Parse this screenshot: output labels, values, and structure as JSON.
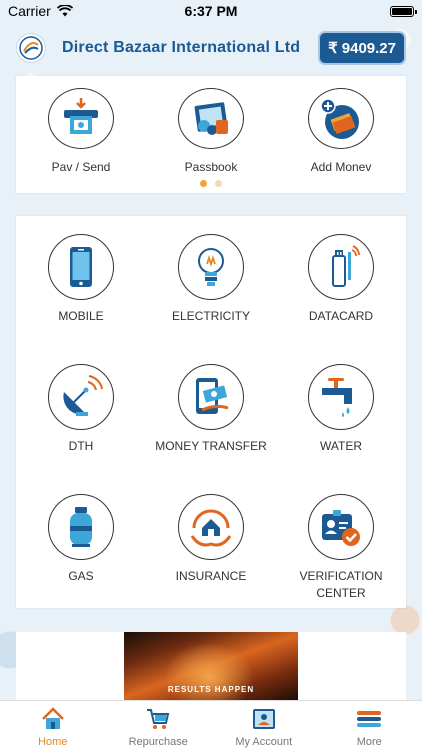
{
  "status_bar": {
    "carrier": "Carrier",
    "time": "6:37 PM"
  },
  "header": {
    "title": "Direct Bazaar International Ltd",
    "balance": "₹ 9409.27"
  },
  "quick_actions": [
    {
      "label": "Pav / Send",
      "icon": "atm-cash-icon"
    },
    {
      "label": "Passbook",
      "icon": "passbook-icon"
    },
    {
      "label": "Add Monev",
      "icon": "add-money-icon"
    }
  ],
  "carousel": {
    "pages": 2,
    "active": 0
  },
  "services": [
    {
      "label": "MOBILE",
      "icon": "mobile-icon"
    },
    {
      "label": "ELECTRICITY",
      "icon": "bulb-icon"
    },
    {
      "label": "DATACARD",
      "icon": "datacard-icon"
    },
    {
      "label": "DTH",
      "icon": "satellite-dish-icon"
    },
    {
      "label": "MONEY TRANSFER",
      "icon": "money-transfer-icon"
    },
    {
      "label": "WATER",
      "icon": "water-tap-icon"
    },
    {
      "label": "GAS",
      "icon": "gas-cylinder-icon"
    },
    {
      "label": "INSURANCE",
      "icon": "insurance-icon"
    },
    {
      "label": "VERIFICATION CENTER",
      "icon": "id-verification-icon"
    }
  ],
  "banner": {
    "text": "RESULTS HAPPEN"
  },
  "tabs": [
    {
      "label": "Home",
      "active": true,
      "icon": "home-icon"
    },
    {
      "label": "Repurchase",
      "active": false,
      "icon": "cart-icon"
    },
    {
      "label": "My Account",
      "active": false,
      "icon": "account-icon"
    },
    {
      "label": "More",
      "active": false,
      "icon": "menu-icon"
    }
  ],
  "colors": {
    "brand_blue": "#1a5a96",
    "accent_orange": "#e08a1f",
    "balance_bg": "#1c5a93"
  }
}
